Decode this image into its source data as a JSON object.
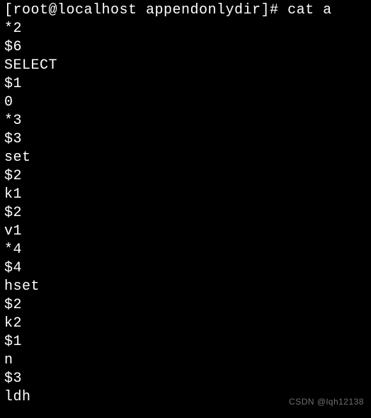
{
  "terminal": {
    "lines": [
      "[root@localhost appendonlydir]# cat a",
      "*2",
      "$6",
      "SELECT",
      "$1",
      "0",
      "*3",
      "$3",
      "set",
      "$2",
      "k1",
      "$2",
      "v1",
      "*4",
      "$4",
      "hset",
      "$2",
      "k2",
      "$1",
      "n",
      "$3",
      "ldh"
    ]
  },
  "watermark": "CSDN @lqh12138"
}
